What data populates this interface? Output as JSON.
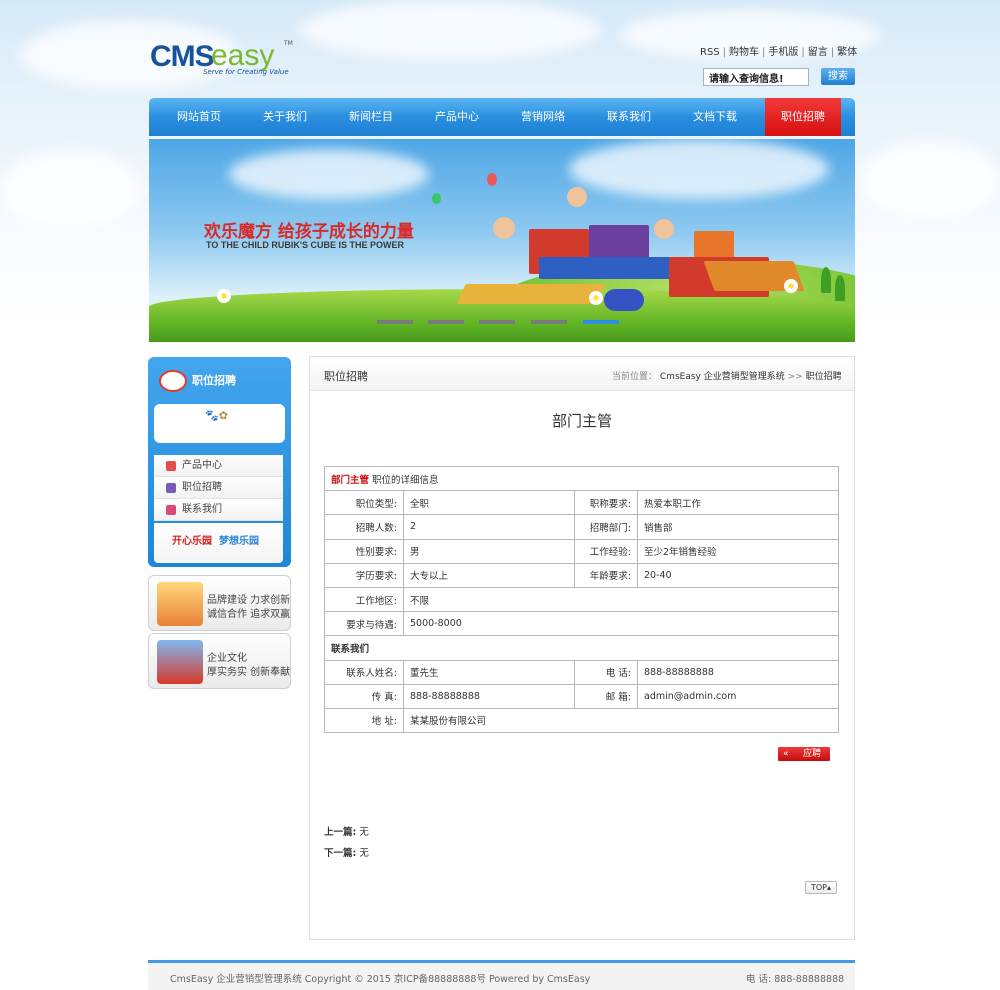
{
  "header": {
    "logo": {
      "brand_left": "CMS",
      "brand_right": "easy",
      "tm": "TM",
      "slogan": "Serve for Creating Value"
    },
    "links": [
      "RSS",
      "购物车",
      "手机版",
      "留言",
      "繁体"
    ],
    "search": {
      "value": "请输入查询信息!",
      "button_label": "搜索"
    }
  },
  "nav": {
    "items": [
      "网站首页",
      "关于我们",
      "新闻栏目",
      "产品中心",
      "营销网络",
      "联系我们",
      "文档下载",
      "职位招聘"
    ],
    "active_index": 7,
    "colors": {
      "bar": "#2a8fe0",
      "active": "#e01e1e"
    }
  },
  "banner": {
    "title": "欢乐魔方 给孩子成长的力量",
    "subtitle": "TO THE CHILD RUBIK'S CUBE IS THE POWER",
    "slide_count": 5,
    "active_slide": 4
  },
  "sidebar": {
    "title": "职位招聘",
    "menu": [
      "产品中心",
      "职位招聘",
      "联系我们"
    ],
    "promo": {
      "left": "开心乐园",
      "right": "梦想乐园"
    },
    "cards": [
      {
        "line1": "品牌建设 力求创新",
        "line2": "诚信合作 追求双赢"
      },
      {
        "line1": "企业文化",
        "line2": "厚实务实 创新奉献"
      }
    ]
  },
  "main": {
    "section_title": "职位招聘",
    "breadcrumb": {
      "label": "当前位置：",
      "home": "CmsEasy 企业营销型管理系统",
      "sep": ">>",
      "current": "职位招聘"
    },
    "job_title": "部门主管",
    "detail_header": {
      "name": "部门主管",
      "suffix": "职位的详细信息"
    },
    "rows": [
      {
        "l1": "职位类型:",
        "v1": "全职",
        "l2": "职称要求:",
        "v2": "热爱本职工作"
      },
      {
        "l1": "招聘人数:",
        "v1": "2",
        "l2": "招聘部门:",
        "v2": "销售部"
      },
      {
        "l1": "性别要求:",
        "v1": "男",
        "l2": "工作经验:",
        "v2": "至少2年销售经验"
      },
      {
        "l1": "学历要求:",
        "v1": "大专以上",
        "l2": "年龄要求:",
        "v2": "20-40"
      }
    ],
    "area": {
      "label": "工作地区:",
      "value": "不限"
    },
    "salary": {
      "label": "要求与待遇:",
      "value": "5000-8000"
    },
    "contact_header": "联系我们",
    "contact_rows": [
      {
        "l1": "联系人姓名:",
        "v1": "董先生",
        "l2": "电 话:",
        "v2": "888-88888888"
      },
      {
        "l1": "传 真:",
        "v1": "888-88888888",
        "l2": "邮 箱:",
        "v2": "admin@admin.com"
      }
    ],
    "address": {
      "label": "地 址:",
      "value": "某某股份有限公司"
    },
    "apply_label": "应聘",
    "prev": {
      "label": "上一篇:",
      "value": "无"
    },
    "next": {
      "label": "下一篇:",
      "value": "无"
    },
    "top_label": "TOP"
  },
  "footer": {
    "text": "CmsEasy 企业营销型管理系统 Copyright © 2015 京ICP备88888888号 Powered by CmsEasy",
    "phone": "电 话: 888-88888888"
  }
}
